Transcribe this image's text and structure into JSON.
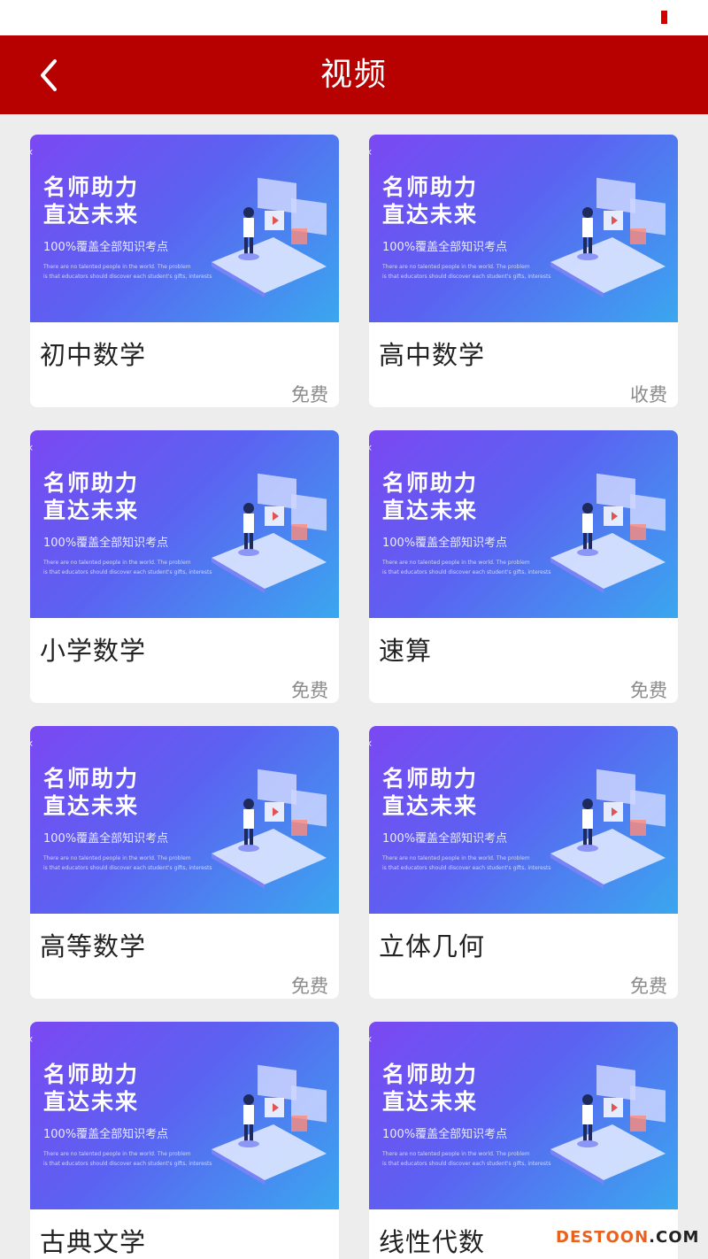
{
  "status_bar": {},
  "nav": {
    "title": "视频"
  },
  "banner": {
    "line1": "名师助力",
    "line2": "直达未来",
    "sub": "100%覆盖全部知识考点",
    "tiny1": "There are no talented people in the world. The problem",
    "tiny2": "is that educators should discover each student's gifts, interests"
  },
  "courses": [
    {
      "title": "初中数学",
      "price": "免费"
    },
    {
      "title": "高中数学",
      "price": "收费"
    },
    {
      "title": "小学数学",
      "price": "免费"
    },
    {
      "title": "速算",
      "price": "免费"
    },
    {
      "title": "高等数学",
      "price": "免费"
    },
    {
      "title": "立体几何",
      "price": "免费"
    },
    {
      "title": "古典文学",
      "price": ""
    },
    {
      "title": "线性代数",
      "price": ""
    }
  ],
  "watermark": {
    "part1": "DESTOON",
    "part2": ".COM"
  },
  "colors": {
    "nav": "#b70000",
    "banner_start": "#7b48f2",
    "banner_end": "#3aa7ef",
    "price": "#8b8b8b"
  }
}
